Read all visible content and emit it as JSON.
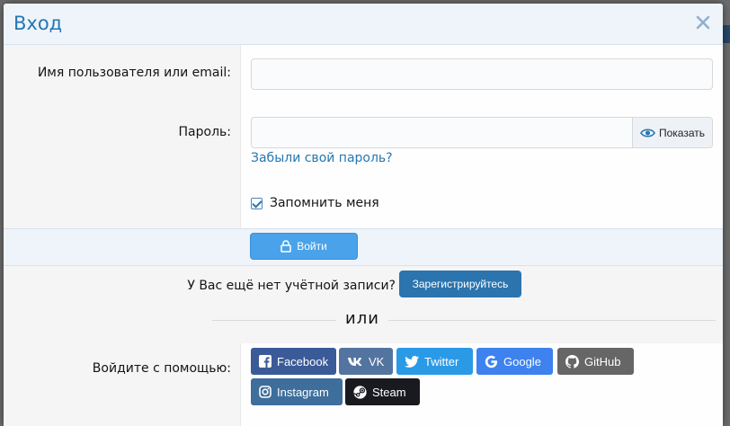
{
  "modal": {
    "title": "Вход"
  },
  "form": {
    "username_label": "Имя пользователя или email:",
    "username_value": "",
    "password_label": "Пароль:",
    "password_value": "",
    "show_label": "Показать",
    "forgot_label": "Забыли свой пароль?",
    "remember_label": "Запомнить меня",
    "remember_checked": true,
    "submit_label": "Войти"
  },
  "register": {
    "prompt": "У Вас ещё нет учётной записи?",
    "button_label": "Зарегистрируйтесь"
  },
  "divider": {
    "text": "или"
  },
  "social": {
    "label": "Войдите с помощью:",
    "buttons": [
      {
        "name": "facebook",
        "label": "Facebook",
        "color": "#3b5a98",
        "icon": "facebook-icon"
      },
      {
        "name": "vk",
        "label": "VK",
        "color": "#5474a0",
        "icon": "vk-icon"
      },
      {
        "name": "twitter",
        "label": "Twitter",
        "color": "#2a9ae6",
        "icon": "twitter-icon"
      },
      {
        "name": "google",
        "label": "Google",
        "color": "#3d82ee",
        "icon": "google-icon"
      },
      {
        "name": "github",
        "label": "GitHub",
        "color": "#666666",
        "icon": "github-icon"
      },
      {
        "name": "instagram",
        "label": "Instagram",
        "color": "#3e6e9b",
        "icon": "instagram-icon"
      },
      {
        "name": "steam",
        "label": "Steam",
        "color": "#181a1f",
        "icon": "steam-icon"
      }
    ]
  },
  "colors": {
    "accent": "#2577b1",
    "header_bg": "#eef4fa",
    "login_button": "#4aa3ea",
    "register_button": "#2b74ae"
  }
}
